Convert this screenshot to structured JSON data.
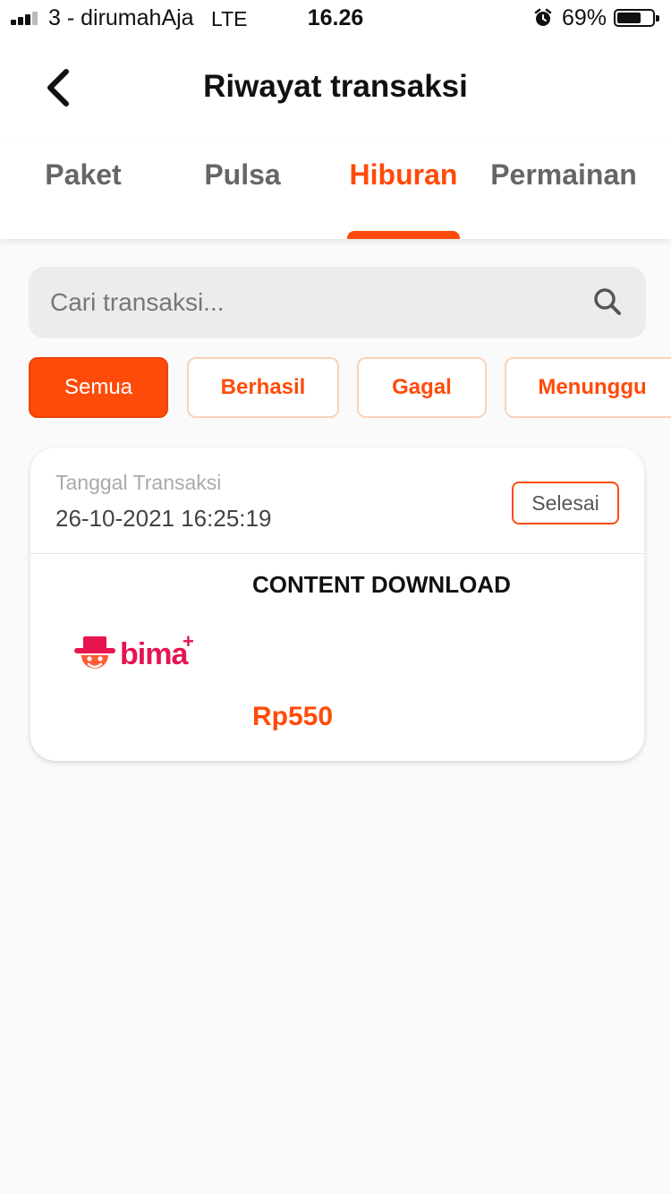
{
  "status_bar": {
    "carrier": "3 - dirumahAja",
    "network": "LTE",
    "time": "16.26",
    "battery_percent": "69%",
    "battery_level": 0.69,
    "icons": [
      "signal-icon",
      "alarm-icon",
      "battery-icon"
    ]
  },
  "header": {
    "title": "Riwayat transaksi",
    "back_icon": "chevron-left-icon"
  },
  "tabs": [
    {
      "label": "Paket",
      "active": false
    },
    {
      "label": "Pulsa",
      "active": false
    },
    {
      "label": "Hiburan",
      "active": true
    },
    {
      "label": "Permainan",
      "active": false
    }
  ],
  "search": {
    "placeholder": "Cari transaksi...",
    "value": "",
    "icon": "search-icon"
  },
  "filters": [
    {
      "label": "Semua",
      "active": true
    },
    {
      "label": "Berhasil",
      "active": false
    },
    {
      "label": "Gagal",
      "active": false
    },
    {
      "label": "Menunggu",
      "active": false
    }
  ],
  "transactions": [
    {
      "date_label": "Tanggal Transaksi",
      "date": "26-10-2021 16:25:19",
      "status": "Selesai",
      "product": "CONTENT DOWNLOAD",
      "logo_text": "bima",
      "logo_sup": "+",
      "price": "Rp550"
    }
  ],
  "colors": {
    "accent": "#ff4b0a",
    "brand_bima": "#e6144f",
    "search_bg": "#ececec",
    "chip_border": "#fad1b8"
  }
}
